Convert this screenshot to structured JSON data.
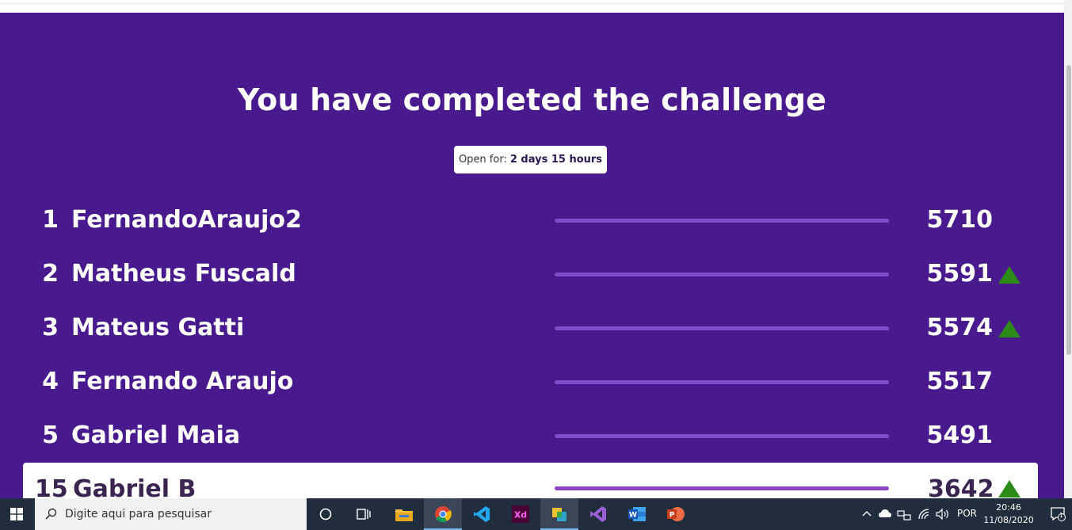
{
  "title": "You have completed the challenge",
  "open_for": {
    "label": "Open for:",
    "value": "2 days 15 hours"
  },
  "leaderboard": [
    {
      "rank": "1",
      "name": "FernandoAraujo2",
      "score": "5710",
      "trend_up": false
    },
    {
      "rank": "2",
      "name": "Matheus Fuscald",
      "score": "5591",
      "trend_up": true
    },
    {
      "rank": "3",
      "name": "Mateus Gatti",
      "score": "5574",
      "trend_up": true
    },
    {
      "rank": "4",
      "name": "Fernando Araujo",
      "score": "5517",
      "trend_up": false
    },
    {
      "rank": "5",
      "name": "Gabriel Maia",
      "score": "5491",
      "trend_up": false
    }
  ],
  "current_user": {
    "rank": "15",
    "name": "Gabriel B",
    "score": "3642",
    "trend_up": true
  },
  "colors": {
    "panel": "#481a8d",
    "bar": "#7e4ec9",
    "up_arrow": "#2c8a17"
  },
  "taskbar": {
    "search_placeholder": "Digite aqui para pesquisar",
    "apps": [
      "cortana-icon",
      "task-view-icon",
      "file-explorer-icon",
      "chrome-icon",
      "vscode-icon",
      "adobe-xd-icon",
      "app-icon",
      "visual-studio-icon",
      "word-icon",
      "powerpoint-icon"
    ],
    "language": "POR",
    "time": "20:46",
    "date": "11/08/2020",
    "notification_count": "1"
  }
}
